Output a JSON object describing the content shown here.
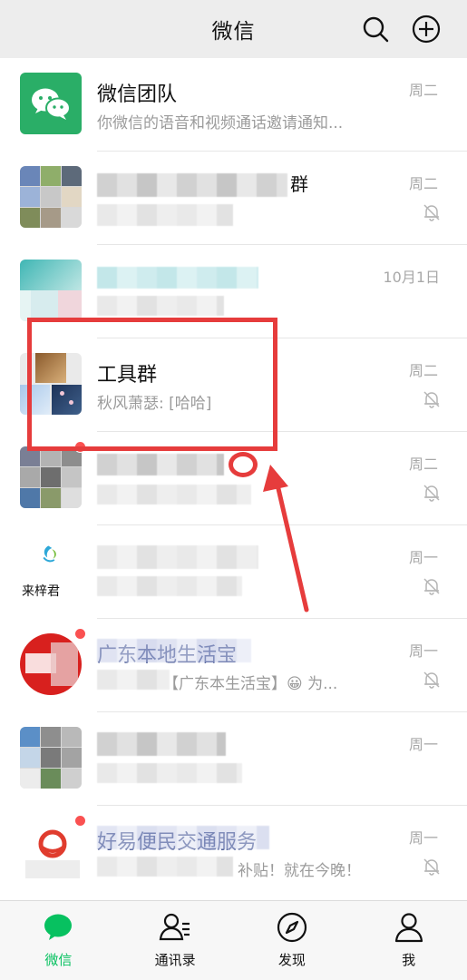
{
  "header": {
    "title": "微信"
  },
  "chats": [
    {
      "name": "微信团队",
      "preview": "你微信的语音和视频通话邀请通知...",
      "time": "周二"
    },
    {
      "name": "群",
      "preview": "",
      "time": "周二"
    },
    {
      "name": "",
      "preview": "",
      "time": "10月1日"
    },
    {
      "name": "工具群",
      "preview": "秋风萧瑟: [哈哈]",
      "time": "周二"
    },
    {
      "name": "",
      "preview": "",
      "time": "周二"
    },
    {
      "name": "",
      "preview": "",
      "time": "周一",
      "avatar_label": "来梓君"
    },
    {
      "name": "广东本地生活宝",
      "preview": "【广东本生活宝】😀 为...",
      "time": "周一"
    },
    {
      "name": "",
      "preview": "",
      "time": "周一"
    },
    {
      "name": "好易便民交通服务",
      "preview": "补贴！就在今晚！",
      "time": "周一"
    }
  ],
  "tabs": [
    {
      "label": "微信",
      "icon": "chat-bubble-icon",
      "active": true
    },
    {
      "label": "通讯录",
      "icon": "contacts-icon",
      "active": false
    },
    {
      "label": "发现",
      "icon": "compass-icon",
      "active": false
    },
    {
      "label": "我",
      "icon": "person-icon",
      "active": false
    }
  ],
  "colors": {
    "accent": "#07c160",
    "annotation": "#e63c3c",
    "badge": "#fa5151"
  }
}
